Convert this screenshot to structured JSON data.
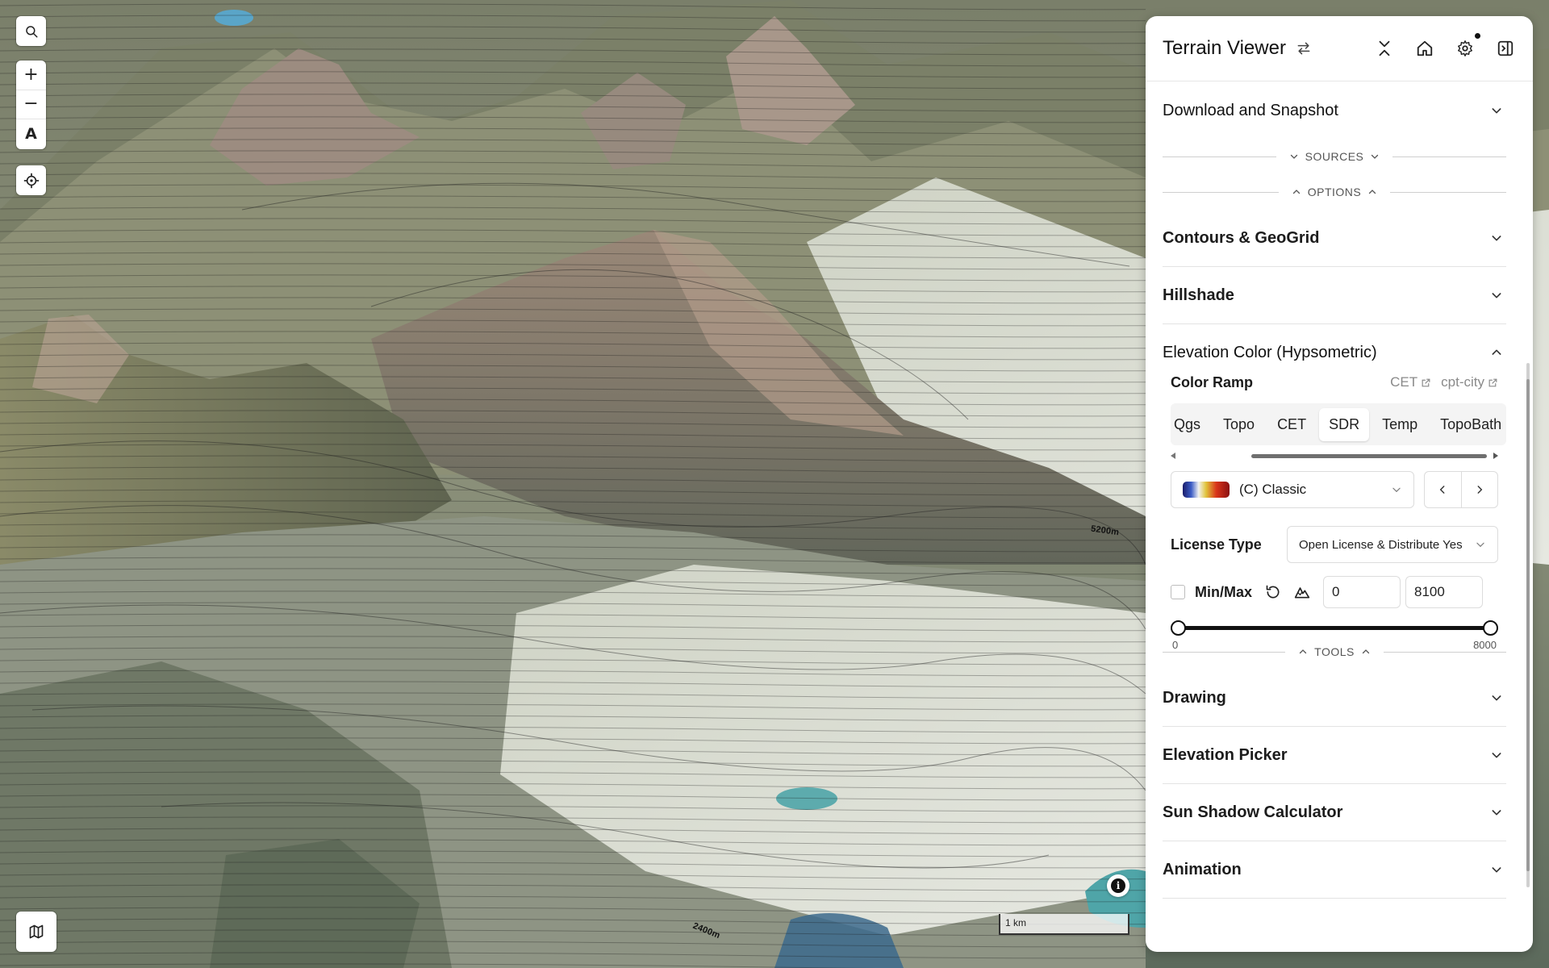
{
  "app": {
    "title": "Terrain Viewer"
  },
  "map": {
    "scale_label": "1 km",
    "contour_labels": [
      "5200m",
      "2400m"
    ],
    "info_glyph": "i",
    "colors": {
      "terrain_base": "#6d7460",
      "snow": "#d9ddd6",
      "lake": "#4fa5a8"
    }
  },
  "panel": {
    "sections_top": [
      {
        "label": "Download and Snapshot"
      }
    ],
    "dividers": {
      "sources": "SOURCES",
      "options": "OPTIONS",
      "tools": "TOOLS"
    },
    "option_sections": [
      {
        "label": "Contours & GeoGrid"
      },
      {
        "label": "Hillshade"
      }
    ],
    "elevation_color": {
      "label": "Elevation Color (Hypsometric)",
      "color_ramp_label": "Color Ramp",
      "links": [
        "CET",
        "cpt-city"
      ],
      "tabs": [
        "Qgs",
        "Topo",
        "CET",
        "SDR",
        "Temp",
        "TopoBath"
      ],
      "active_tab": "SDR",
      "selected_ramp": "(C) Classic",
      "license_label": "License Type",
      "license_value": "Open License & Distribute Yes",
      "minmax_label": "Min/Max",
      "min_value": "0",
      "max_value": "8100",
      "slider_min_label": "0",
      "slider_max_label": "8000",
      "slider_min_fraction": 0.0,
      "slider_max_fraction": 1.0
    },
    "tool_sections": [
      {
        "label": "Drawing"
      },
      {
        "label": "Elevation Picker"
      },
      {
        "label": "Sun Shadow Calculator"
      },
      {
        "label": "Animation"
      }
    ],
    "icons": [
      "swap-icon",
      "collapse-icon",
      "home-icon",
      "gear-icon",
      "sidebar-toggle-icon"
    ]
  }
}
